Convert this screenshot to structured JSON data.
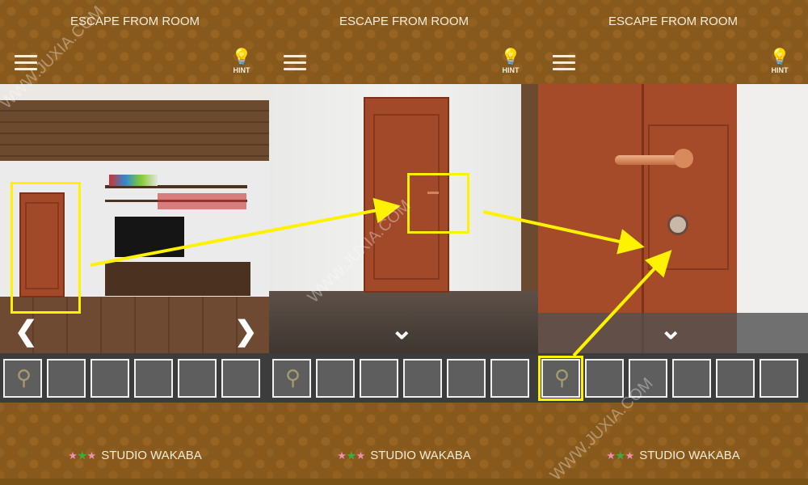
{
  "panels": [
    {
      "title": "ESCAPE FROM ROOM",
      "hint_label": "HINT"
    },
    {
      "title": "ESCAPE FROM ROOM",
      "hint_label": "HINT"
    },
    {
      "title": "ESCAPE FROM ROOM",
      "hint_label": "HINT"
    }
  ],
  "footer": {
    "studio": "STUDIO WAKABA"
  },
  "inventory": {
    "slots": 6,
    "item": "key-icon"
  },
  "watermark": "WWW.JUXIA.COM",
  "colors": {
    "header": "#87591c",
    "highlight": "#fff200",
    "door": "#a2492a",
    "inventory_bg": "#3c3c3c"
  }
}
